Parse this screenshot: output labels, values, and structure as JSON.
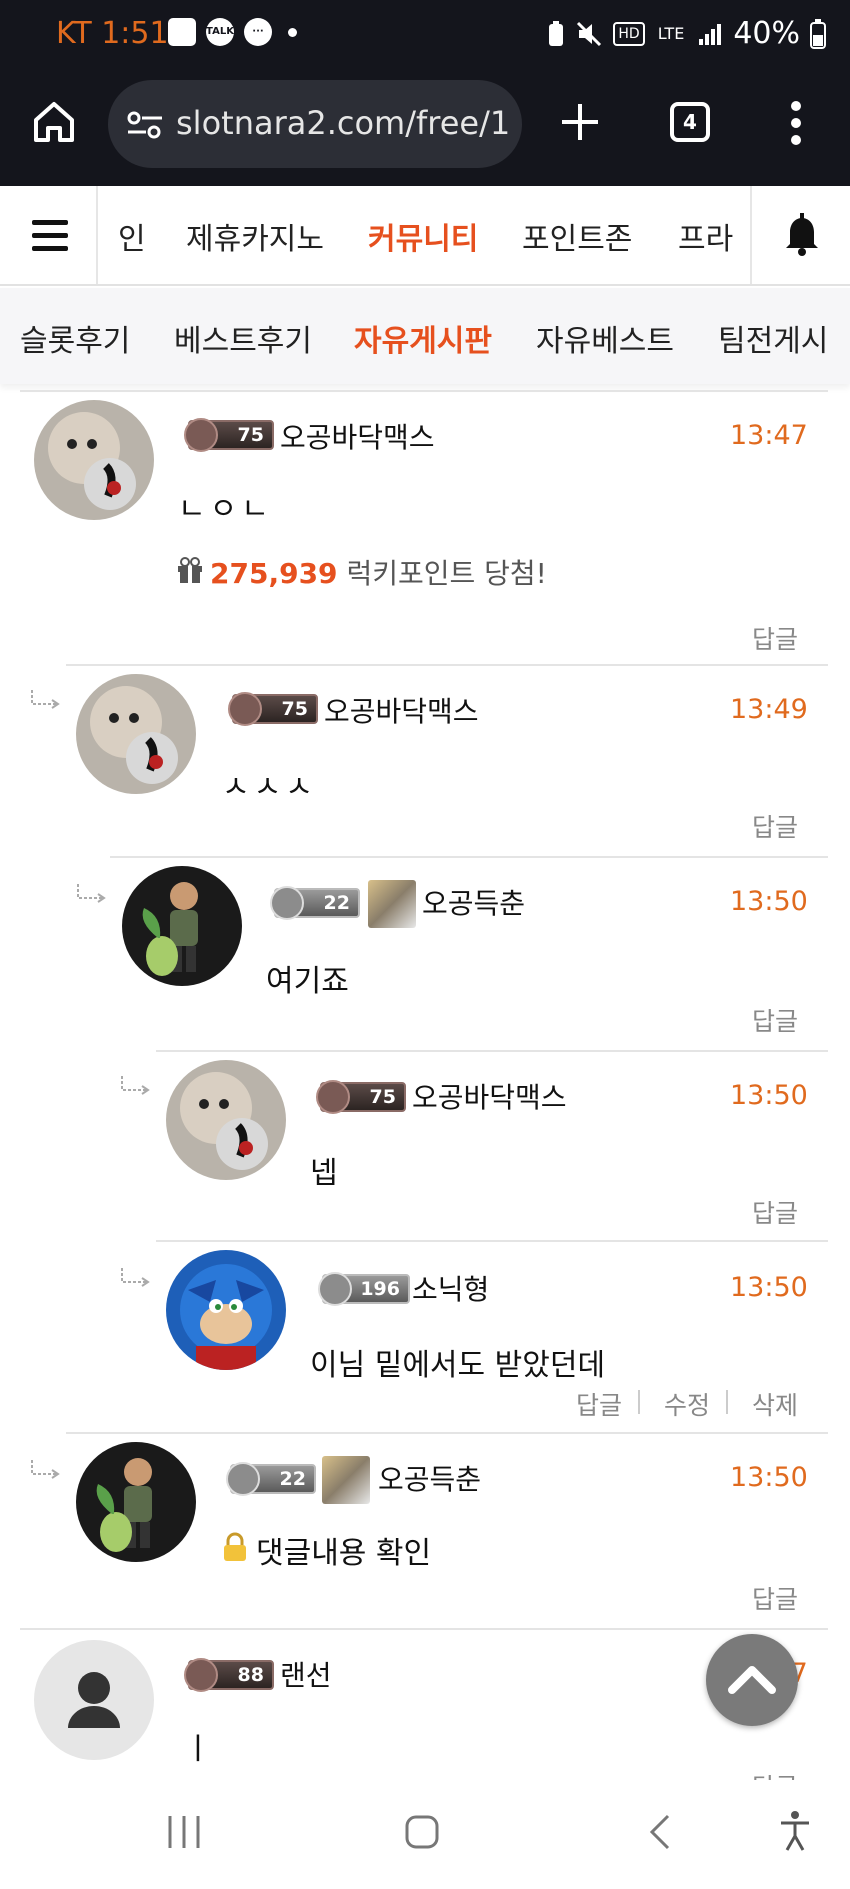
{
  "status": {
    "time": "KT 1:51",
    "net": "LTE",
    "hd": "HD",
    "battery": "40%",
    "talk_badge": "TALK"
  },
  "browser": {
    "url": "slotnara2.com/free/1",
    "tab_count": "4"
  },
  "nav": {
    "items": [
      "인",
      "제휴카지노",
      "커뮤니티",
      "포인트존",
      "프라"
    ],
    "active": "커뮤니티"
  },
  "subnav": {
    "items": [
      "슬롯후기",
      "베스트후기",
      "자유게시판",
      "자유베스트",
      "팀전게시"
    ],
    "active": "자유게시판"
  },
  "comments": [
    {
      "level": "75",
      "nick": "오공바닥맥스",
      "time": "13:47",
      "text": "ㄴㅇㄴ",
      "reply": "답글",
      "points_value": "275,939",
      "points_label": "럭키포인트 당첨!"
    },
    {
      "level": "75",
      "nick": "오공바닥맥스",
      "time": "13:49",
      "text": "ㅅㅅㅅ",
      "reply": "답글"
    },
    {
      "level": "22",
      "nick": "오공득춘",
      "time": "13:50",
      "text": "여기죠",
      "reply": "답글"
    },
    {
      "level": "75",
      "nick": "오공바닥맥스",
      "time": "13:50",
      "text": "넵",
      "reply": "답글"
    },
    {
      "level": "196",
      "nick": "소닉형",
      "time": "13:50",
      "text": "이님 밑에서도 받았던데",
      "reply": "답글",
      "edit": "수정",
      "delete": "삭제"
    },
    {
      "level": "22",
      "nick": "오공득춘",
      "time": "13:50",
      "text": "댓글내용 확인",
      "reply": "답글"
    },
    {
      "level": "88",
      "nick": "랜선",
      "time": "13:47",
      "text": "ㅣ",
      "reply": "답글"
    }
  ]
}
